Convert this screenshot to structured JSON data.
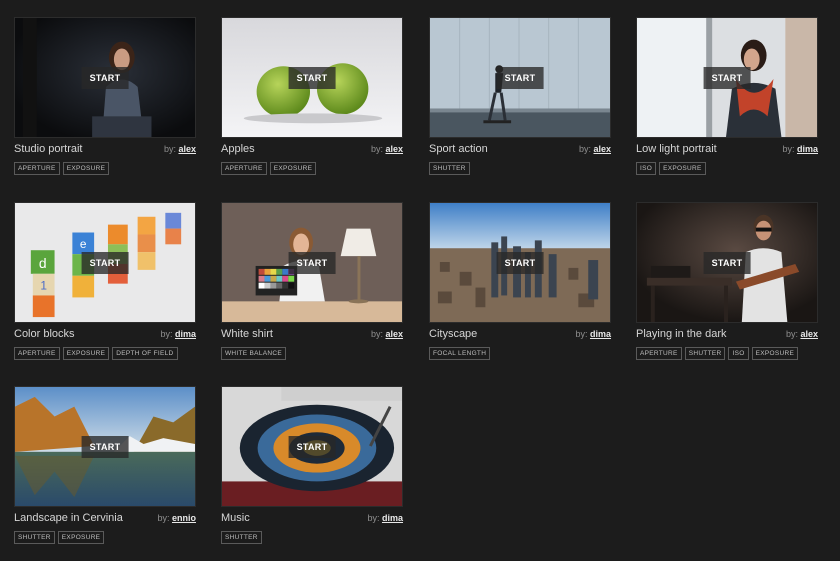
{
  "start_label": "START",
  "by_prefix": "by:",
  "cards": [
    {
      "title": "Studio portrait",
      "author": "alex",
      "tags": [
        "APERTURE",
        "EXPOSURE"
      ]
    },
    {
      "title": "Apples",
      "author": "alex",
      "tags": [
        "APERTURE",
        "EXPOSURE"
      ]
    },
    {
      "title": "Sport action",
      "author": "alex",
      "tags": [
        "SHUTTER"
      ]
    },
    {
      "title": "Low light portrait",
      "author": "dima",
      "tags": [
        "ISO",
        "EXPOSURE"
      ]
    },
    {
      "title": "Color blocks",
      "author": "dima",
      "tags": [
        "APERTURE",
        "EXPOSURE",
        "DEPTH OF FIELD"
      ]
    },
    {
      "title": "White shirt",
      "author": "alex",
      "tags": [
        "WHITE BALANCE"
      ]
    },
    {
      "title": "Cityscape",
      "author": "dima",
      "tags": [
        "FOCAL LENGTH"
      ]
    },
    {
      "title": "Playing in the dark",
      "author": "alex",
      "tags": [
        "APERTURE",
        "SHUTTER",
        "ISO",
        "EXPOSURE"
      ]
    },
    {
      "title": "Landscape in Cervinia",
      "author": "ennio",
      "tags": [
        "SHUTTER",
        "EXPOSURE"
      ]
    },
    {
      "title": "Music",
      "author": "dima",
      "tags": [
        "SHUTTER"
      ]
    }
  ]
}
